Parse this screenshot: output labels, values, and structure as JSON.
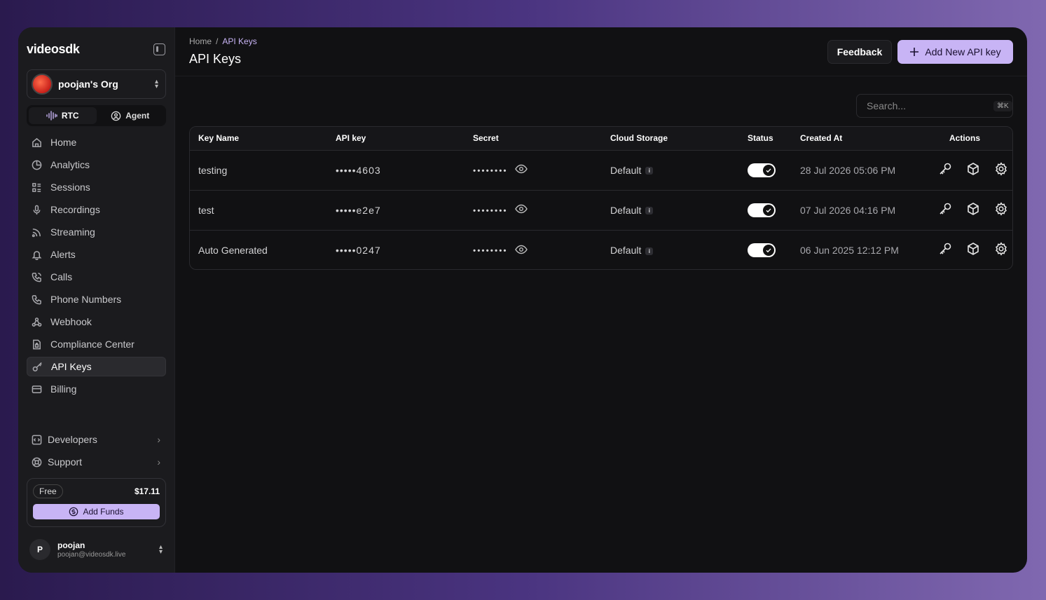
{
  "sidebar": {
    "logo": "videosdk",
    "org_name": "poojan's Org",
    "modes": [
      {
        "label": "RTC"
      },
      {
        "label": "Agent"
      }
    ],
    "items": [
      {
        "label": "Home",
        "icon": "home-icon"
      },
      {
        "label": "Analytics",
        "icon": "analytics-icon"
      },
      {
        "label": "Sessions",
        "icon": "sessions-icon"
      },
      {
        "label": "Recordings",
        "icon": "mic-icon"
      },
      {
        "label": "Streaming",
        "icon": "streaming-icon"
      },
      {
        "label": "Alerts",
        "icon": "bell-icon"
      },
      {
        "label": "Calls",
        "icon": "calls-icon"
      },
      {
        "label": "Phone Numbers",
        "icon": "phone-icon"
      },
      {
        "label": "Webhook",
        "icon": "webhook-icon"
      },
      {
        "label": "Compliance Center",
        "icon": "compliance-icon"
      },
      {
        "label": "API Keys",
        "icon": "key-icon",
        "active": true
      },
      {
        "label": "Billing",
        "icon": "billing-icon"
      }
    ],
    "bottom_items": [
      {
        "label": "Developers",
        "icon": "code-icon"
      },
      {
        "label": "Support",
        "icon": "lifebuoy-icon"
      }
    ],
    "funds": {
      "plan": "Free",
      "balance": "$17.11",
      "button": "Add Funds"
    },
    "user": {
      "initial": "P",
      "name": "poojan",
      "email": "poojan@videosdk.live"
    }
  },
  "header": {
    "breadcrumb_home": "Home",
    "breadcrumb_sep": "/",
    "breadcrumb_current": "API Keys",
    "title": "API Keys",
    "feedback_label": "Feedback",
    "add_key_label": "Add New API key"
  },
  "search": {
    "placeholder": "Search...",
    "shortcut": "⌘K"
  },
  "table": {
    "headers": [
      "Key Name",
      "API key",
      "Secret",
      "Cloud Storage",
      "Status",
      "Created At",
      "Actions"
    ],
    "rows": [
      {
        "name": "testing",
        "api_key": "•••••4603",
        "secret": "••••••••",
        "storage": "Default",
        "status": true,
        "created": "28 Jul 2026 05:06 PM"
      },
      {
        "name": "test",
        "api_key": "•••••e2e7",
        "secret": "••••••••",
        "storage": "Default",
        "status": true,
        "created": "07 Jul 2026 04:16 PM"
      },
      {
        "name": "Auto Generated",
        "api_key": "•••••0247",
        "secret": "••••••••",
        "storage": "Default",
        "status": true,
        "created": "06 Jun 2025 12:12 PM"
      }
    ]
  },
  "colors": {
    "accent": "#c8b4f5",
    "background": "#111113",
    "sidebar": "#1b1b1e"
  }
}
